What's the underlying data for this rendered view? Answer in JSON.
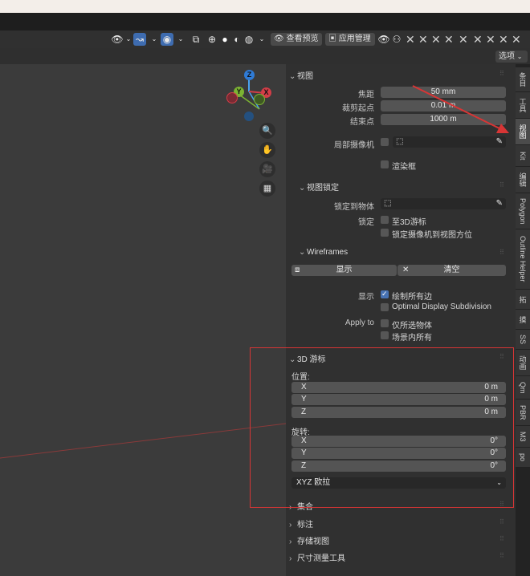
{
  "header": {
    "view_preview_label": "查看预览",
    "app_manager_label": "应用管理",
    "options_label": "选项"
  },
  "view": {
    "title": "视图",
    "focal_length_label": "焦距",
    "focal_length_value": "50 mm",
    "clip_start_label": "裁剪起点",
    "clip_start_value": "0.01 m",
    "clip_end_label": "结束点",
    "clip_end_value": "1000 m",
    "local_camera_label": "局部摄像机",
    "render_region_label": "渲染框"
  },
  "view_lock": {
    "title": "视图锁定",
    "lock_to_object_label": "锁定到物体",
    "lock_label": "锁定",
    "to_3d_cursor_label": "至3D游标",
    "camera_to_view_label": "锁定摄像机到视图方位"
  },
  "wireframes": {
    "title": "Wireframes",
    "show_button_label": "显示",
    "clear_button_label": "清空",
    "display_label": "显示",
    "draw_all_edges_label": "绘制所有边",
    "optimal_subdivision_label": "Optimal Display Subdivision",
    "apply_to_label": "Apply to",
    "selected_only_label": "仅所选物体",
    "all_in_scene_label": "场景内所有"
  },
  "cursor3d": {
    "title": "3D 游标",
    "location_label": "位置:",
    "x_label": "X",
    "x_value": "0 m",
    "y_label": "Y",
    "y_value": "0 m",
    "z_label": "Z",
    "z_value": "0 m",
    "rotation_label": "旋转:",
    "rx_label": "X",
    "rx_value": "0°",
    "ry_label": "Y",
    "ry_value": "0°",
    "rz_label": "Z",
    "rz_value": "0°",
    "rotation_mode": "XYZ 欧拉"
  },
  "collapsed_sections": {
    "collection": "集合",
    "annotation": "标注",
    "stored_views": "存储视图",
    "measure_tools": "尺寸测量工具"
  },
  "sidebar_tabs": [
    "条目",
    "工具",
    "视图",
    "Kit",
    "编辑",
    "Polygon",
    "Outline Helper",
    "拓",
    "摸",
    "SS",
    "动画",
    "Qm",
    "PBR",
    "M3",
    "po"
  ],
  "gizmo": {
    "z_label": "Z",
    "y_label": "Y",
    "x_label": "X"
  },
  "colors": {
    "annotation_red": "#d83535",
    "checkbox_blue": "#4772b3",
    "axis_x": "#d23d47",
    "axis_y": "#7cb333",
    "axis_z": "#2f7bd6"
  }
}
